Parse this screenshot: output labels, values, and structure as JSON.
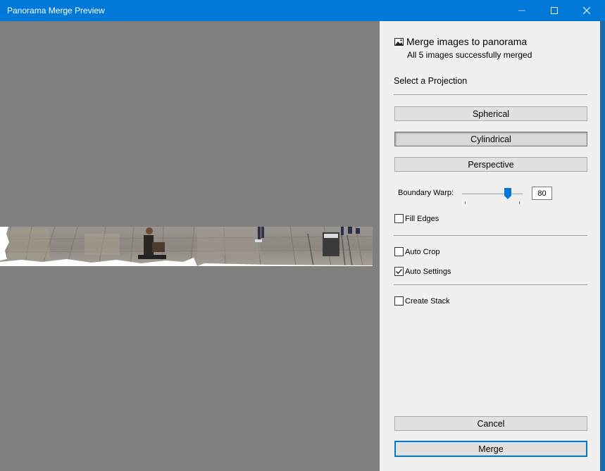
{
  "window": {
    "title": "Panorama Merge Preview",
    "controls": [
      "minimize",
      "maximize",
      "close"
    ]
  },
  "header": {
    "icon": "panorama-icon",
    "title": "Merge images to panorama",
    "subtitle": "All 5 images successfully merged"
  },
  "projection": {
    "label": "Select a Projection",
    "options": [
      {
        "label": "Spherical",
        "pressed": false
      },
      {
        "label": "Cylindrical",
        "pressed": true
      },
      {
        "label": "Perspective",
        "pressed": false
      }
    ]
  },
  "boundary_warp": {
    "label": "Boundary Warp:",
    "value": "80"
  },
  "options": {
    "fill_edges": {
      "label": "Fill Edges",
      "checked": false
    },
    "auto_crop": {
      "label": "Auto Crop",
      "checked": false
    },
    "auto_settings": {
      "label": "Auto Settings",
      "checked": true
    },
    "create_stack": {
      "label": "Create Stack",
      "checked": false
    }
  },
  "actions": {
    "cancel": "Cancel",
    "merge": "Merge"
  },
  "colors": {
    "titlebar": "#0078d7",
    "preview_bg": "#7f7f7f",
    "panel_bg": "#f0f0f0",
    "accent": "#0078d7"
  }
}
